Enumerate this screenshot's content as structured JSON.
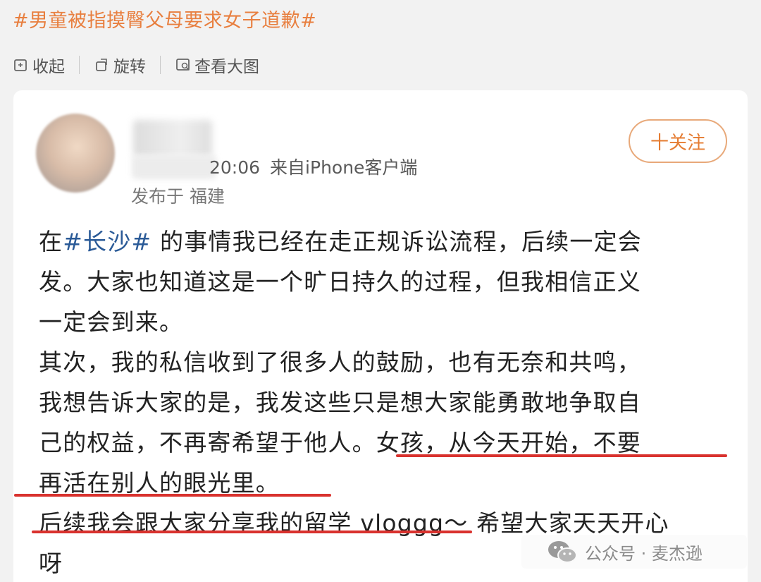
{
  "topic_tag": "#男童被指摸臀父母要求女子道歉#",
  "toolbar": {
    "collapse_label": "收起",
    "rotate_label": "旋转",
    "view_large_label": "查看大图"
  },
  "post": {
    "time": "20:06",
    "source": "来自iPhone客户端",
    "location": "发布于 福建",
    "follow_label": "十关注",
    "lines": [
      {
        "pre": "在",
        "tag": "#长沙#",
        "post": " 的事情我已经在走正规诉讼流程，后续一定会"
      },
      {
        "text": "发。大家也知道这是一个旷日持久的过程，但我相信正义"
      },
      {
        "text": "一定会到来。"
      },
      {
        "text": "其次，我的私信收到了很多人的鼓励，也有无奈和共鸣，"
      },
      {
        "text": "我想告诉大家的是，我发这些只是想大家能勇敢地争取自"
      },
      {
        "text": "己的权益，不再寄希望于他人。女孩，从今天开始，不要"
      },
      {
        "text": "再活在别人的眼光里。"
      },
      {
        "text": "后续我会跟大家分享我的留学 vloggg～ 希望大家天天开心"
      },
      {
        "text": "呀"
      }
    ]
  },
  "watermark": {
    "text": "公众号 · 麦杰逊"
  },
  "colors": {
    "topic": "#e87f3f",
    "hashtag": "#2a5a97",
    "underline": "#d9322e",
    "follow": "#e57c32",
    "background": "#f2f2f2",
    "card": "#ffffff"
  },
  "icons": {
    "collapse": "collapse-icon",
    "rotate": "rotate-icon",
    "view_large": "view-large-icon",
    "wechat": "wechat-icon"
  }
}
